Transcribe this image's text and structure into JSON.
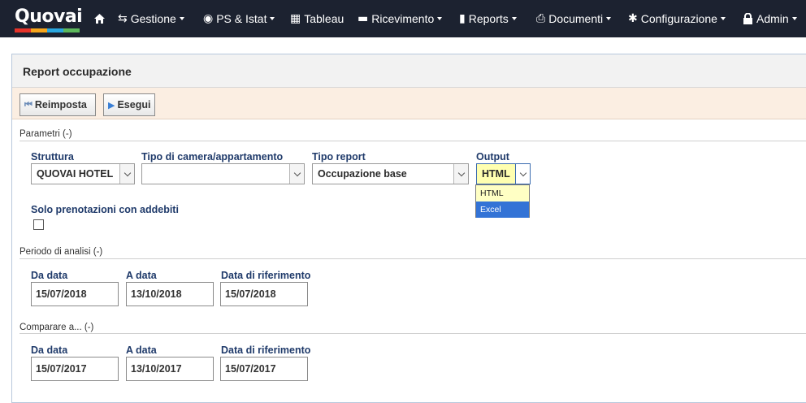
{
  "app": {
    "logo": "Quovai",
    "logo_colors": [
      "#e63329",
      "#f6a51c",
      "#2aa7df",
      "#5cb85c"
    ]
  },
  "nav": {
    "home_icon": "home-icon",
    "items": [
      {
        "label": "Gestione",
        "icon": "retweet-icon",
        "glyph": "⇆",
        "caret": true
      },
      {
        "label": "PS & Istat",
        "icon": "eye-icon",
        "glyph": "◉",
        "caret": true
      },
      {
        "label": "Tableau",
        "icon": "calendar-icon",
        "glyph": "▦",
        "caret": false
      },
      {
        "label": "Ricevimento",
        "icon": "briefcase-icon",
        "glyph": "▬",
        "caret": true
      },
      {
        "label": "Reports",
        "icon": "bar-chart-icon",
        "glyph": "▮",
        "caret": true
      },
      {
        "label": "Documenti",
        "icon": "print-icon",
        "glyph": "⎙",
        "caret": true
      },
      {
        "label": "Configurazione",
        "icon": "gear-icon",
        "glyph": "✱",
        "caret": true
      },
      {
        "label": "Admin",
        "icon": "lock-icon",
        "glyph": "🔒",
        "caret": true
      }
    ]
  },
  "panel": {
    "title": "Report occupazione",
    "reset_label": "Reimposta",
    "run_label": "Esegui"
  },
  "params": {
    "section": "Parametri (-)",
    "struttura_label": "Struttura",
    "struttura_value": "QUOVAI HOTEL",
    "tipo_camera_label": "Tipo di camera/appartamento",
    "tipo_camera_value": "",
    "tipo_report_label": "Tipo report",
    "tipo_report_value": "Occupazione base",
    "output_label": "Output",
    "output_value": "HTML",
    "output_options": [
      "HTML",
      "Excel"
    ],
    "solo_label": "Solo prenotazioni con addebiti",
    "solo_checked": false
  },
  "periodo": {
    "section": "Periodo di analisi (-)",
    "da_label": "Da data",
    "da_value": "15/07/2018",
    "a_label": "A data",
    "a_value": "13/10/2018",
    "rif_label": "Data di riferimento",
    "rif_value": "15/07/2018"
  },
  "comparare": {
    "section": "Comparare a... (-)",
    "da_label": "Da data",
    "da_value": "15/07/2017",
    "a_label": "A data",
    "a_value": "13/10/2017",
    "rif_label": "Data di riferimento",
    "rif_value": "15/07/2017"
  }
}
